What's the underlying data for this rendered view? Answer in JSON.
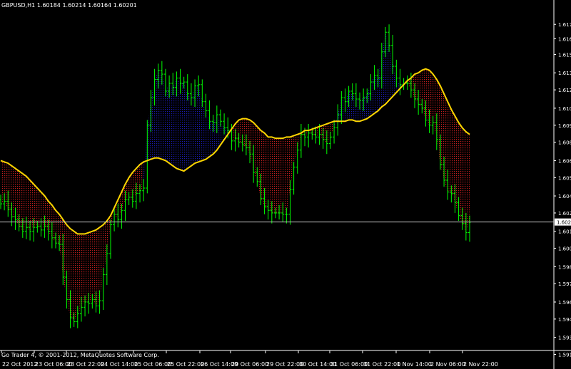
{
  "header": {
    "symbol": "GBPUSD,H1",
    "ohlc": "1.60184 1.60214 1.60164 1.60201"
  },
  "footer": {
    "copyright": "Go Trader 4, © 2001-2012, MetaQuotes Software Corp."
  },
  "current_price_label": "1.602",
  "colors": {
    "background": "#000000",
    "candle": "#00ff00",
    "moving_average": "#ffd700",
    "fill_above": "#1a1ab4",
    "fill_below": "#c81e1e",
    "price_line": "#c0c0c0",
    "axis_text": "#ffffff"
  },
  "chart_data": {
    "type": "line",
    "title": "GBPUSD,H1",
    "xlabel": "",
    "ylabel": "",
    "ylim": [
      1.5922,
      1.6182
    ],
    "current_price": 1.60201,
    "grid": false,
    "x_tick_labels": [
      "22 Oct 2012",
      "23 Oct 06:00",
      "23 Oct 22:00",
      "24 Oct 14:00",
      "25 Oct 06:00",
      "25 Oct 22:00",
      "26 Oct 14:00",
      "29 Oct 06:00",
      "29 Oct 22:00",
      "30 Oct 14:00",
      "31 Oct 06:00",
      "31 Oct 22:00",
      "1 Nov 14:00",
      "2 Nov 06:00",
      "2 Nov 22:00"
    ],
    "y_tick_labels": [
      "1.617",
      "1.616",
      "1.615",
      "1.613",
      "1.612",
      "1.610",
      "1.609",
      "1.608",
      "1.606",
      "1.605",
      "1.604",
      "1.602",
      "1.601",
      "1.600",
      "1.598",
      "1.597",
      "1.596",
      "1.594",
      "1.593",
      "1.591"
    ],
    "y_tick_values": [
      1.6171,
      1.616,
      1.6148,
      1.6134,
      1.6121,
      1.6107,
      1.6094,
      1.6081,
      1.6067,
      1.6054,
      1.604,
      1.6027,
      1.6013,
      1.6,
      1.5986,
      1.5973,
      1.5959,
      1.5946,
      1.5932,
      1.5919
    ],
    "series": [
      {
        "label": "close",
        "values": [
          1.6034,
          1.6036,
          1.603,
          1.6024,
          1.6022,
          1.6017,
          1.6013,
          1.6016,
          1.6013,
          1.6016,
          1.6017,
          1.6014,
          1.6017,
          1.6013,
          1.6008,
          1.6004,
          1.6003,
          1.5978,
          1.5961,
          1.5947,
          1.5944,
          1.595,
          1.5955,
          1.5959,
          1.5958,
          1.5961,
          1.5956,
          1.596,
          1.598,
          1.5996,
          1.6018,
          1.6026,
          1.6022,
          1.6029,
          1.6037,
          1.6039,
          1.6036,
          1.6042,
          1.6044,
          1.6046,
          1.6094,
          1.6115,
          1.6129,
          1.6136,
          1.6133,
          1.612,
          1.6126,
          1.6123,
          1.613,
          1.6126,
          1.6127,
          1.6118,
          1.6115,
          1.6124,
          1.6125,
          1.6112,
          1.6105,
          1.6097,
          1.6096,
          1.6102,
          1.6097,
          1.6092,
          1.609,
          1.6082,
          1.6084,
          1.6081,
          1.6079,
          1.6077,
          1.6072,
          1.6058,
          1.6051,
          1.6038,
          1.6032,
          1.6029,
          1.6027,
          1.6027,
          1.6027,
          1.6026,
          1.6026,
          1.6045,
          1.6062,
          1.6075,
          1.6087,
          1.6085,
          1.6088,
          1.6087,
          1.6085,
          1.6087,
          1.6083,
          1.608,
          1.6085,
          1.6092,
          1.6102,
          1.6115,
          1.6112,
          1.612,
          1.6118,
          1.6114,
          1.6113,
          1.6115,
          1.6118,
          1.6127,
          1.6132,
          1.613,
          1.615,
          1.6165,
          1.6155,
          1.6139,
          1.613,
          1.6125,
          1.6126,
          1.6126,
          1.6121,
          1.6114,
          1.611,
          1.6107,
          1.6098,
          1.6094,
          1.6096,
          1.6083,
          1.6064,
          1.6052,
          1.6043,
          1.6042,
          1.6035,
          1.6025,
          1.6019,
          1.6012,
          1.602
        ]
      },
      {
        "label": "moving average",
        "values": [
          1.6067,
          1.6066,
          1.6065,
          1.6063,
          1.6061,
          1.6059,
          1.6057,
          1.6055,
          1.6052,
          1.6049,
          1.6046,
          1.6043,
          1.604,
          1.6036,
          1.6033,
          1.6029,
          1.6026,
          1.6022,
          1.6018,
          1.6015,
          1.6013,
          1.6011,
          1.6011,
          1.6011,
          1.6012,
          1.6013,
          1.6014,
          1.6016,
          1.6018,
          1.6021,
          1.6025,
          1.6031,
          1.6037,
          1.6043,
          1.6049,
          1.6054,
          1.6058,
          1.6061,
          1.6064,
          1.6066,
          1.6067,
          1.6068,
          1.6069,
          1.6069,
          1.6068,
          1.6067,
          1.6065,
          1.6063,
          1.6061,
          1.606,
          1.6059,
          1.6061,
          1.6063,
          1.6065,
          1.6066,
          1.6067,
          1.6068,
          1.607,
          1.6072,
          1.6075,
          1.6079,
          1.6083,
          1.6087,
          1.6091,
          1.6095,
          1.6098,
          1.6099,
          1.6099,
          1.6098,
          1.6096,
          1.6093,
          1.609,
          1.6088,
          1.6085,
          1.6085,
          1.6084,
          1.6084,
          1.6084,
          1.6085,
          1.6085,
          1.6086,
          1.6087,
          1.6088,
          1.609,
          1.609,
          1.6091,
          1.6092,
          1.6093,
          1.6094,
          1.6095,
          1.6096,
          1.6097,
          1.6097,
          1.6097,
          1.6097,
          1.6098,
          1.6098,
          1.6097,
          1.6097,
          1.6098,
          1.6099,
          1.6101,
          1.6103,
          1.6105,
          1.6108,
          1.611,
          1.6113,
          1.6116,
          1.6119,
          1.6122,
          1.6125,
          1.6128,
          1.613,
          1.6133,
          1.6134,
          1.6136,
          1.6137,
          1.6136,
          1.6133,
          1.6129,
          1.6124,
          1.6118,
          1.6112,
          1.6106,
          1.6101,
          1.6096,
          1.6092,
          1.6089,
          1.6087
        ]
      }
    ]
  }
}
